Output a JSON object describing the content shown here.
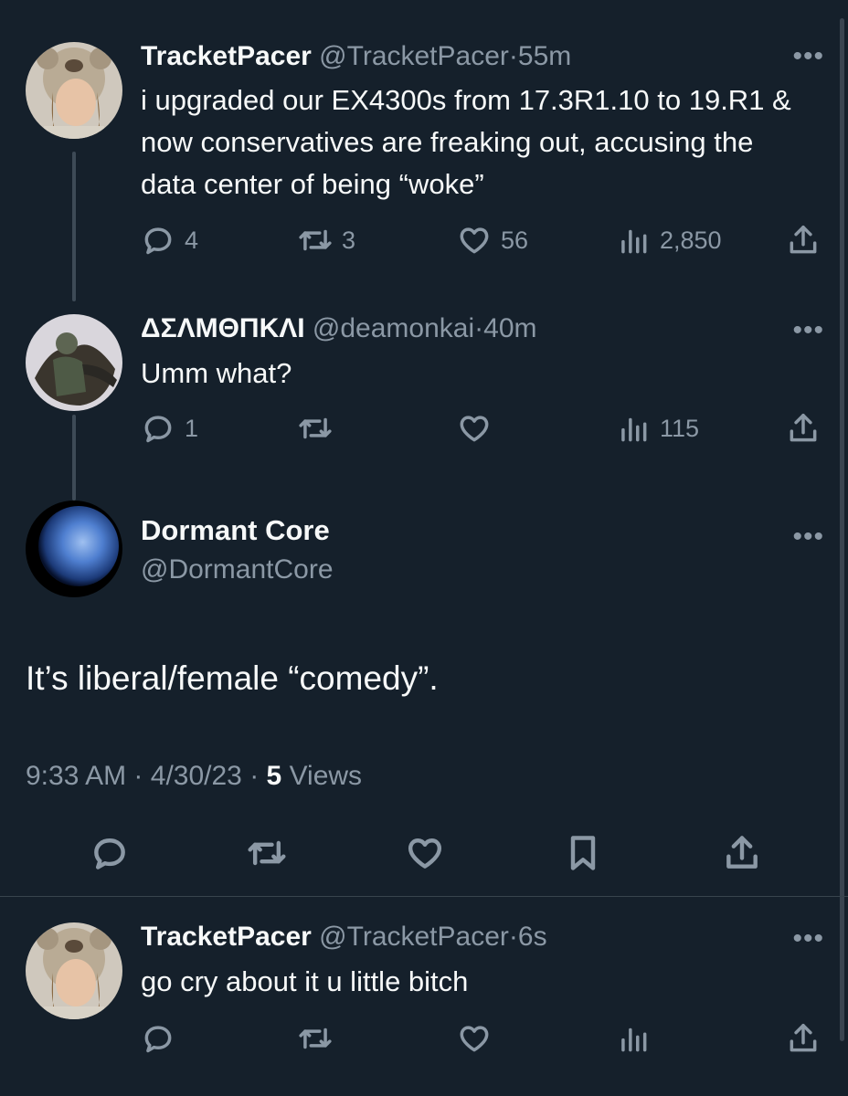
{
  "tweets": [
    {
      "name": "TracketPacer",
      "handle": "@TracketPacer",
      "time": "55m",
      "text": "i upgraded our EX4300s from 17.3R1.10 to 19.R1 & now conservatives are freaking out, accusing the data center of being “woke”",
      "replies": "4",
      "retweets": "3",
      "likes": "56",
      "views": "2,850"
    },
    {
      "name": "ΔΣΛΜΘΠΚΛΙ",
      "handle": "@deamonkai",
      "time": "40m",
      "text": "Umm what?",
      "replies": "1",
      "retweets": "",
      "likes": "",
      "views": "115"
    }
  ],
  "main_tweet": {
    "name": "Dormant Core",
    "handle": "@DormantCore",
    "text": "It’s liberal/female “comedy”.",
    "time": "9:33 AM",
    "date": "4/30/23",
    "views_count": "5",
    "views_label": "Views"
  },
  "reply": {
    "name": "TracketPacer",
    "handle": "@TracketPacer",
    "time": "6s",
    "text": "go cry about it u little bitch"
  },
  "separator": "·",
  "more_glyph": "•••",
  "icons": [
    "reply-icon",
    "retweet-icon",
    "like-icon",
    "views-icon",
    "share-icon",
    "bookmark-icon",
    "more-icon"
  ],
  "colors": {
    "background": "#15202b",
    "text": "#f7f9f9",
    "muted": "#8b98a5",
    "divider": "#38444d"
  }
}
